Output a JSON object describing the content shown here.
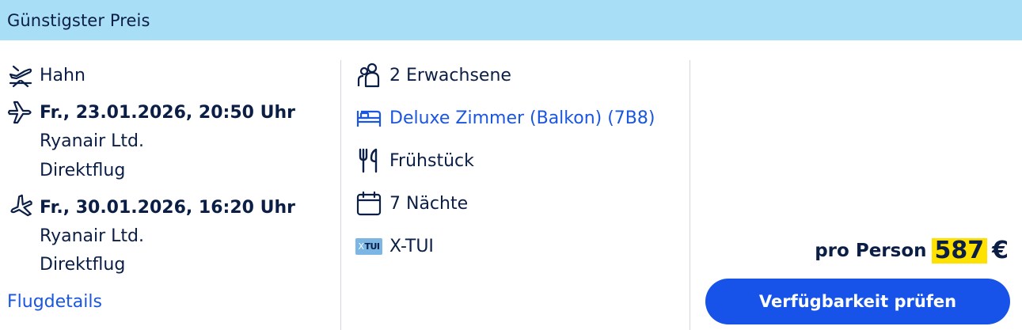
{
  "header": {
    "title": "Günstigster Preis"
  },
  "flight": {
    "departure_airport": "Hahn",
    "outbound": {
      "datetime": "Fr., 23.01.2026, 20:50 Uhr",
      "airline": "Ryanair Ltd.",
      "type": "Direktflug"
    },
    "return": {
      "datetime": "Fr., 30.01.2026, 16:20 Uhr",
      "airline": "Ryanair Ltd.",
      "type": "Direktflug"
    },
    "details_link": "Flugdetails"
  },
  "hotel": {
    "travellers": "2 Erwachsene",
    "room": "Deluxe Zimmer (Balkon) (7B8)",
    "board": "Frühstück",
    "nights": "7 Nächte",
    "operator_badge": "TUI",
    "operator_badge_prefix": "X",
    "operator": "X-TUI"
  },
  "price": {
    "label": "pro Person",
    "value": "587",
    "currency": "€",
    "highlight_color": "#ffe100"
  },
  "cta": {
    "label": "Verfügbarkeit prüfen",
    "color": "#1753e8"
  },
  "colors": {
    "header_bg": "#a9def7",
    "text": "#0b1e45",
    "link": "#1a56e0"
  },
  "icons": [
    "plane-airport-icon",
    "plane-departure-icon",
    "plane-return-icon",
    "travellers-icon",
    "bed-icon",
    "cutlery-icon",
    "calendar-icon",
    "xtui-badge-icon"
  ]
}
